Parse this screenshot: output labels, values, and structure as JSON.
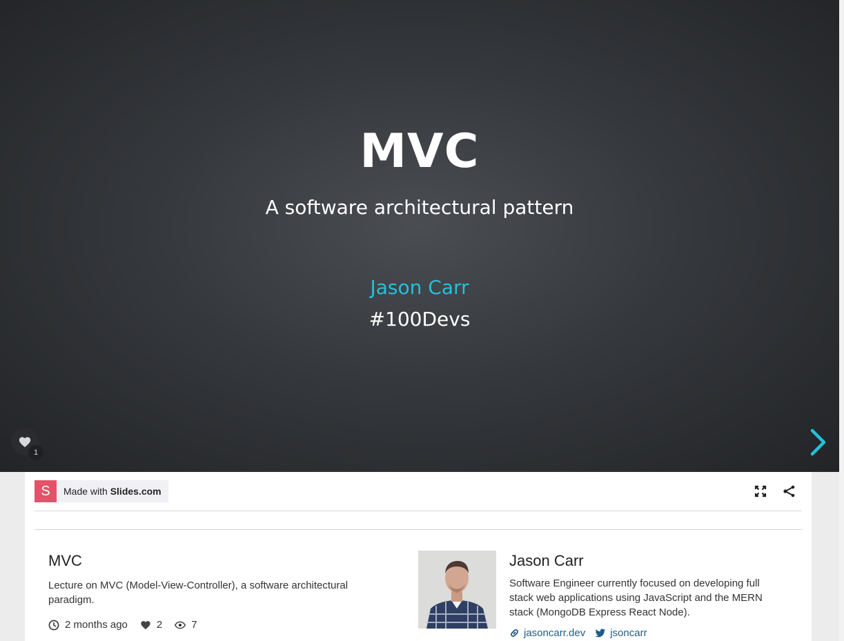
{
  "slide": {
    "title": "MVC",
    "subtitle": "A software architectural pattern",
    "author": "Jason Carr",
    "tag": "#100Devs",
    "like_count": "1",
    "colors": {
      "accent": "#21c3dc",
      "background": "#35383c"
    }
  },
  "toolbar": {
    "logo_letter": "S",
    "made_with_prefix": "Made with",
    "made_with_brand": "Slides.com",
    "fullscreen_icon": "fullscreen-icon",
    "share_icon": "share-icon"
  },
  "deck": {
    "title": "MVC",
    "description": "Lecture on MVC (Model-View-Controller), a software architectural paradigm.",
    "updated": "2 months ago",
    "likes": "2",
    "views": "7"
  },
  "author": {
    "name": "Jason Carr",
    "bio": "Software Engineer currently focused on developing full stack web applications using JavaScript and the MERN stack (MongoDB Express React Node).",
    "website": "jasoncarr.dev",
    "twitter": "jsoncarr"
  }
}
